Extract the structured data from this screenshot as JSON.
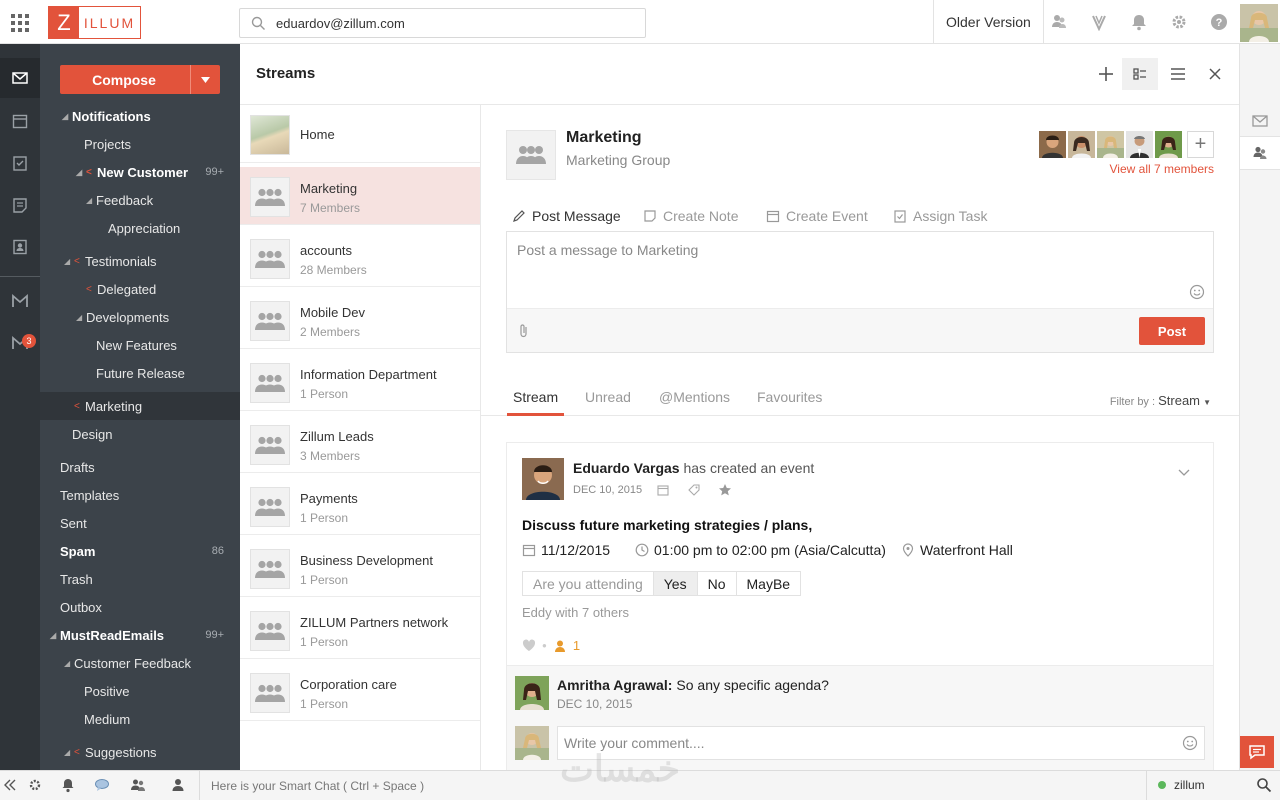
{
  "app": {
    "logo_letter": "Z",
    "logo_text": "ILLUM",
    "brand_color": "#e2533b"
  },
  "topbar": {
    "search_value": "eduardov@zillum.com",
    "older_version_label": "Older Version",
    "icons": [
      "apps-grid-icon",
      "search-icon",
      "streams-icon",
      "vault-icon",
      "bell-icon",
      "gear-icon",
      "help-icon",
      "user-avatar"
    ]
  },
  "rail": {
    "icons": [
      "mail-icon",
      "calendar-icon",
      "tasks-icon",
      "notes-icon",
      "contacts-icon",
      "gmail-icon",
      "gmail-alt-icon"
    ],
    "badge_count": "3"
  },
  "folders": {
    "compose_label": "Compose",
    "items": [
      {
        "label": "Notifications",
        "bold": true
      },
      {
        "label": "Projects"
      },
      {
        "label": "New Customer",
        "bold": true,
        "count": "99+"
      },
      {
        "label": "Feedback"
      },
      {
        "label": "Appreciation"
      },
      {
        "label": "Testimonials"
      },
      {
        "label": "Delegated"
      },
      {
        "label": "Developments"
      },
      {
        "label": "New Features"
      },
      {
        "label": "Future Release"
      },
      {
        "label": "Marketing"
      },
      {
        "label": "Design"
      },
      {
        "label": "Drafts"
      },
      {
        "label": "Templates"
      },
      {
        "label": "Sent"
      },
      {
        "label": "Spam",
        "bold": true,
        "count": "86"
      },
      {
        "label": "Trash"
      },
      {
        "label": "Outbox"
      },
      {
        "label": "MustReadEmails",
        "bold": true,
        "count": "99+"
      },
      {
        "label": "Customer Feedback"
      },
      {
        "label": "Positive"
      },
      {
        "label": "Medium"
      },
      {
        "label": "Suggestions"
      }
    ]
  },
  "streams": {
    "title": "Streams",
    "groups": [
      {
        "name": "Home",
        "sub": ""
      },
      {
        "name": "Marketing",
        "sub": "7 Members"
      },
      {
        "name": "accounts",
        "sub": "28 Members"
      },
      {
        "name": "Mobile Dev",
        "sub": "2 Members"
      },
      {
        "name": "Information Department",
        "sub": "1 Person"
      },
      {
        "name": "Zillum Leads",
        "sub": "3 Members"
      },
      {
        "name": "Payments",
        "sub": "1 Person"
      },
      {
        "name": "Business Development",
        "sub": "1 Person"
      },
      {
        "name": "ZILLUM Partners network",
        "sub": "1 Person"
      },
      {
        "name": "Corporation care",
        "sub": "1 Person"
      }
    ]
  },
  "detail": {
    "group_title": "Marketing",
    "group_subtitle": "Marketing Group",
    "view_all": "View all 7 members",
    "actions": {
      "post": "Post Message",
      "note": "Create Note",
      "event": "Create Event",
      "task": "Assign Task"
    },
    "composer_placeholder": "Post a message to Marketing",
    "post_button": "Post",
    "tabs": {
      "stream": "Stream",
      "unread": "Unread",
      "mentions": "@Mentions",
      "favourites": "Favourites"
    },
    "filter_label": "Filter by :",
    "filter_value": "Stream"
  },
  "post": {
    "author": "Eduardo Vargas",
    "action": "has created an event",
    "date": "DEC 10, 2015",
    "event_title": "Discuss future marketing strategies / plans,",
    "event_date": "11/12/2015",
    "event_time": "01:00 pm to 02:00 pm (Asia/Calcutta)",
    "event_location": "Waterfront Hall",
    "rsvp_question": "Are you attending",
    "rsvp_yes": "Yes",
    "rsvp_no": "No",
    "rsvp_maybe": "MayBe",
    "attendees": "Eddy with 7 others",
    "attendee_count": "1",
    "comment_author": "Amritha Agrawal:",
    "comment_text": "So any specific agenda?",
    "comment_date": "DEC 10, 2015",
    "comment_placeholder": "Write your comment...."
  },
  "bottom": {
    "smart_chat": "Here is your Smart Chat ( Ctrl + Space )",
    "user": "zillum"
  },
  "watermark": "خمسات"
}
